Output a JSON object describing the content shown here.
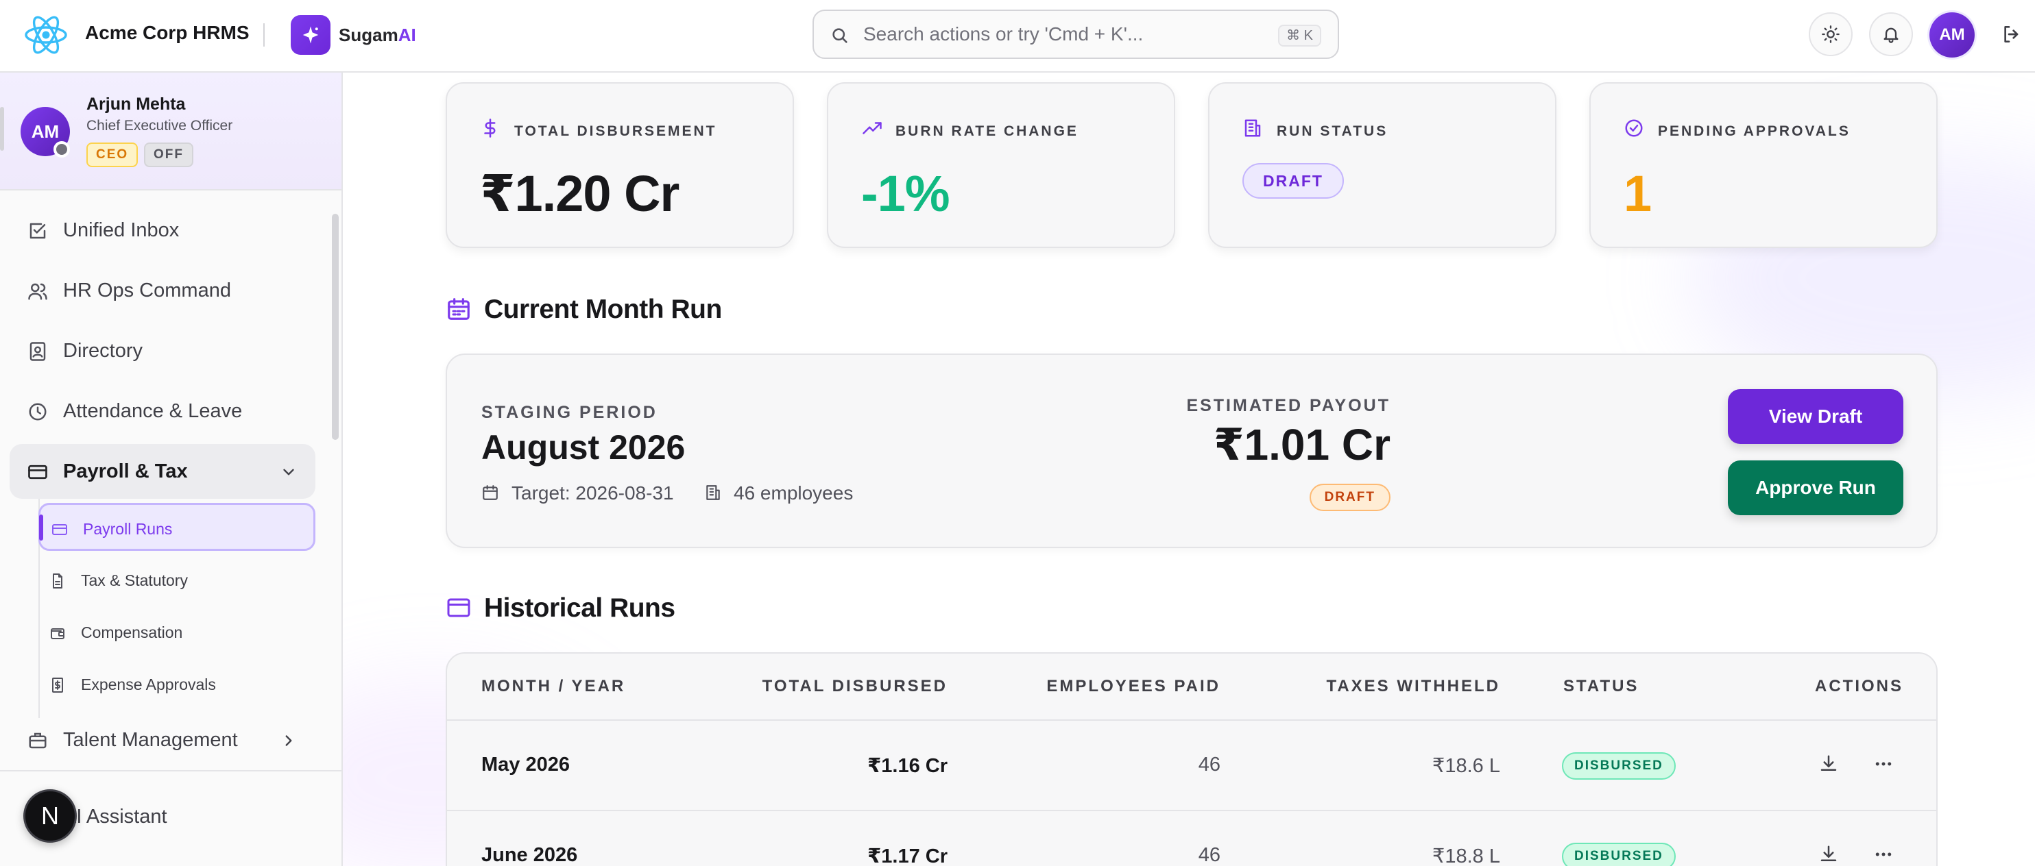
{
  "app": {
    "brand_name": "Acme Corp HRMS",
    "assistant_prefix": "Sugam",
    "assistant_suffix": "AI",
    "accent_color": "#7c3aed"
  },
  "search": {
    "placeholder": "Search actions or try 'Cmd + K'...",
    "shortcut": "⌘ K"
  },
  "header": {
    "avatar_initials": "AM",
    "icons": [
      "react-logo-icon",
      "sparkle-icon",
      "search-icon",
      "sun-icon",
      "bell-icon",
      "logout-icon"
    ]
  },
  "profile": {
    "initials": "AM",
    "name": "Arjun Mehta",
    "role": "Chief Executive Officer",
    "badges": [
      "CEO",
      "OFF"
    ]
  },
  "sidebar": {
    "items": [
      {
        "label": "Unified Inbox",
        "icon": "checkbox-icon"
      },
      {
        "label": "HR Ops Command",
        "icon": "users-icon"
      },
      {
        "label": "Directory",
        "icon": "contact-book-icon"
      },
      {
        "label": "Attendance & Leave",
        "icon": "clock-icon"
      },
      {
        "label": "Payroll & Tax",
        "icon": "credit-card-icon",
        "expanded": true
      },
      {
        "label": "Talent Management",
        "icon": "briefcase-icon"
      }
    ],
    "payroll_subitems": [
      {
        "label": "Payroll Runs",
        "icon": "card-icon",
        "active": true
      },
      {
        "label": "Tax & Statutory",
        "icon": "document-icon"
      },
      {
        "label": "Compensation",
        "icon": "wallet-icon"
      },
      {
        "label": "Expense Approvals",
        "icon": "receipt-icon"
      }
    ],
    "assistant_label": "AI Assistant",
    "next_badge": "N"
  },
  "stats": [
    {
      "label": "TOTAL DISBURSEMENT",
      "value": "₹1.20 Cr",
      "icon": "dollar-icon"
    },
    {
      "label": "BURN RATE CHANGE",
      "value": "-1%",
      "icon": "trending-up-icon",
      "color": "#10b981"
    },
    {
      "label": "RUN STATUS",
      "value": "DRAFT",
      "icon": "building-icon"
    },
    {
      "label": "PENDING APPROVALS",
      "value": "1",
      "icon": "check-circle-icon",
      "color": "#f59e0b"
    }
  ],
  "current_run": {
    "title": "Current Month Run",
    "period_label": "STAGING PERIOD",
    "period": "August 2026",
    "target": "Target: 2026-08-31",
    "employees": "46 employees",
    "payout_label": "ESTIMATED PAYOUT",
    "payout": "₹1.01 Cr",
    "status": "DRAFT",
    "view_button": "View Draft",
    "approve_button": "Approve Run"
  },
  "history": {
    "title": "Historical Runs",
    "columns": [
      "MONTH / YEAR",
      "TOTAL DISBURSED",
      "EMPLOYEES PAID",
      "TAXES WITHHELD",
      "STATUS",
      "ACTIONS"
    ],
    "rows": [
      {
        "month": "May 2026",
        "total": "₹1.16 Cr",
        "employees": "46",
        "taxes": "₹18.6 L",
        "status": "DISBURSED"
      },
      {
        "month": "June 2026",
        "total": "₹1.17 Cr",
        "employees": "46",
        "taxes": "₹18.8 L",
        "status": "DISBURSED"
      }
    ]
  }
}
